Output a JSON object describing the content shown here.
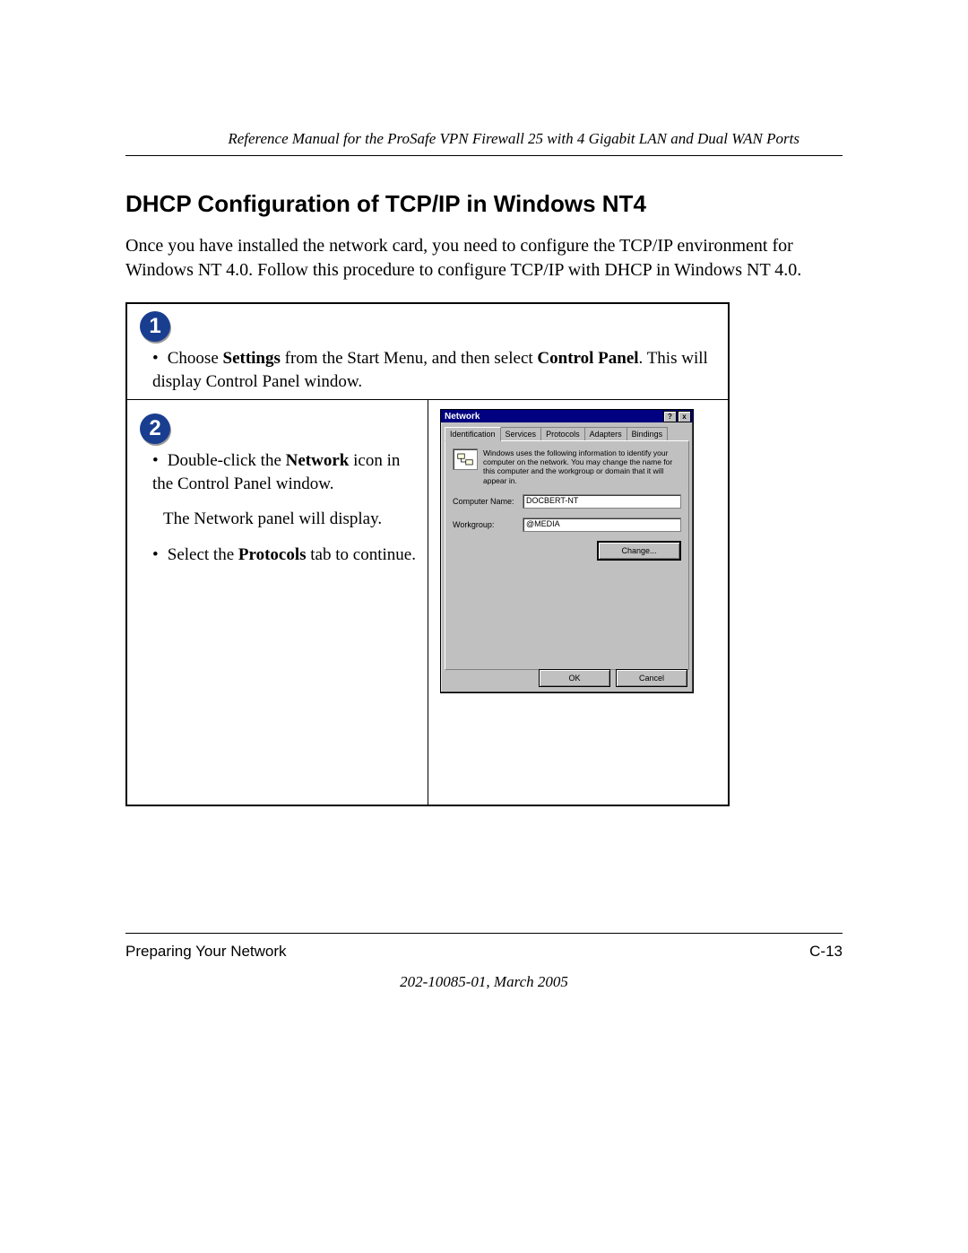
{
  "header": {
    "running": "Reference Manual for the ProSafe VPN Firewall 25 with 4 Gigabit LAN and Dual WAN Ports"
  },
  "section": {
    "title": "DHCP Configuration of TCP/IP in Windows NT4",
    "intro": "Once you have installed the network card, you need to configure the TCP/IP environment for Windows NT 4.0. Follow this procedure to configure TCP/IP with DHCP in Windows NT 4.0."
  },
  "steps": {
    "one": {
      "num": "1",
      "pre": "Choose ",
      "b1": "Settings",
      "mid": " from the Start Menu, and then select ",
      "b2": "Control Panel",
      "post": ". This will display Control Panel window."
    },
    "two": {
      "num": "2",
      "l1_pre": "Double-click the ",
      "l1_b": "Network",
      "l1_post": " icon in the Control Panel window.",
      "l2": "The Network panel will display.",
      "l3_pre": "Select the ",
      "l3_b": "Protocols",
      "l3_post": " tab to continue."
    }
  },
  "dialog": {
    "title": "Network",
    "help": "?",
    "close": "x",
    "tabs": {
      "identification": "Identification",
      "services": "Services",
      "protocols": "Protocols",
      "adapters": "Adapters",
      "bindings": "Bindings"
    },
    "info": "Windows uses the following information to identify your computer on the network.  You may change the name for this computer and the workgroup or domain that it will appear in.",
    "computer_label": "Computer Name:",
    "computer_value": "DOCBERT-NT",
    "workgroup_label": "Workgroup:",
    "workgroup_value": "@MEDIA",
    "change": "Change...",
    "ok": "OK",
    "cancel": "Cancel"
  },
  "footer": {
    "section": "Preparing Your Network",
    "page": "C-13",
    "docnum": "202-10085-01, March 2005"
  }
}
